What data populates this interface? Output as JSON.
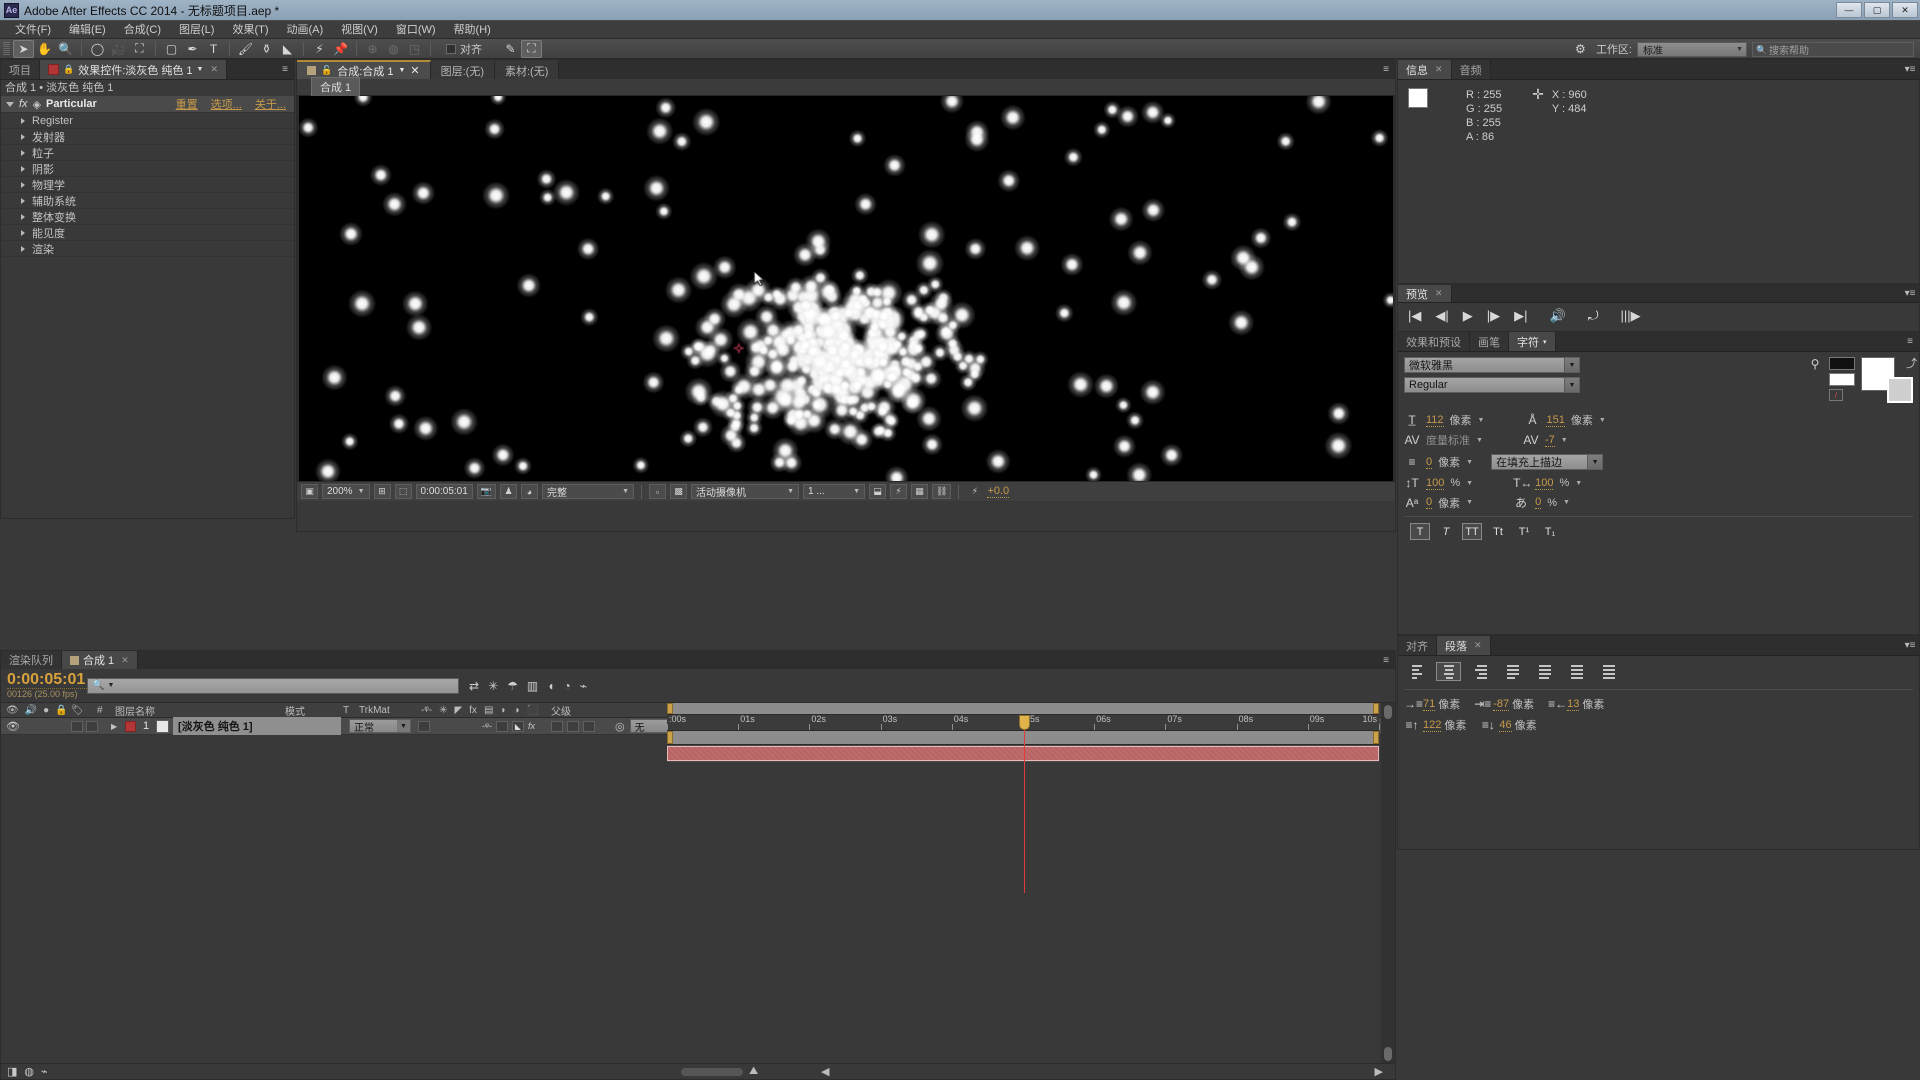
{
  "window": {
    "title": "Adobe After Effects CC 2014 - 无标题项目.aep *",
    "logo": "Ae",
    "minimize": "—",
    "maximize": "▢",
    "close": "✕"
  },
  "menubar": {
    "items": [
      "文件(F)",
      "编辑(E)",
      "合成(C)",
      "图层(L)",
      "效果(T)",
      "动画(A)",
      "视图(V)",
      "窗口(W)",
      "帮助(H)"
    ]
  },
  "toolbar": {
    "tools": [
      {
        "name": "selection-tool",
        "glyph": "➤",
        "active": true
      },
      {
        "name": "hand-tool",
        "glyph": "✋",
        "active": false
      },
      {
        "name": "zoom-tool",
        "glyph": "🔍",
        "active": false
      },
      {
        "name": "rotation-tool",
        "glyph": "◯",
        "active": false
      },
      {
        "name": "camera-tool",
        "glyph": "🎥",
        "active": false
      },
      {
        "name": "pan-behind-tool",
        "glyph": "⛶",
        "active": false
      },
      {
        "name": "shape-tool",
        "glyph": "▢",
        "active": false
      },
      {
        "name": "pen-tool",
        "glyph": "✒",
        "active": false
      },
      {
        "name": "text-tool",
        "glyph": "T",
        "active": false
      },
      {
        "name": "brush-tool",
        "glyph": "🖌",
        "active": false
      },
      {
        "name": "clone-stamp-tool",
        "glyph": "⚱",
        "active": false
      },
      {
        "name": "eraser-tool",
        "glyph": "◣",
        "active": false
      },
      {
        "name": "roto-brush-tool",
        "glyph": "⚡",
        "active": false
      },
      {
        "name": "puppet-pin-tool",
        "glyph": "📌",
        "active": false
      }
    ],
    "align_label": "对齐",
    "workspace_label": "工作区:",
    "workspace_value": "标准",
    "search_placeholder": "搜索帮助"
  },
  "effect_controls": {
    "tabs": [
      {
        "label": "项目",
        "active": false
      },
      {
        "label": "效果控件:淡灰色 纯色 1",
        "active": true
      }
    ],
    "breadcrumb": "合成 1 • 淡灰色 纯色 1",
    "effect_name": "Particular",
    "links": [
      "重置",
      "选项...",
      "关于..."
    ],
    "groups": [
      "Register",
      "发射器",
      "粒子",
      "阴影",
      "物理学",
      "辅助系统",
      "整体变换",
      "能见度",
      "渲染"
    ]
  },
  "composition": {
    "tabs": [
      {
        "label": "合成:合成 1",
        "active": true
      },
      {
        "label": "图层:(无)",
        "active": false
      },
      {
        "label": "素材:(无)",
        "active": false
      }
    ],
    "breadcrumb": "合成 1",
    "viewer_bar": {
      "zoom": "200%",
      "timecode": "0:00:05:01",
      "quality": "完整",
      "camera": "活动摄像机",
      "views": "1 ...",
      "exposure": "+0.0"
    }
  },
  "info_panel": {
    "tabs": [
      {
        "label": "信息",
        "active": true
      },
      {
        "label": "音频",
        "active": false
      }
    ],
    "r_label": "R :",
    "r_value": "255",
    "g_label": "G :",
    "g_value": "255",
    "b_label": "B :",
    "b_value": "255",
    "a_label": "A :",
    "a_value": "86",
    "x_label": "X :",
    "x_value": "960",
    "y_label": "Y :",
    "y_value": "484",
    "swatch_color": "#ffffff"
  },
  "preview_panel": {
    "tab": "预览",
    "buttons": [
      "first-frame",
      "previous-frame",
      "play",
      "next-frame",
      "last-frame",
      "audio",
      "loop",
      "ram-preview"
    ]
  },
  "character_panel": {
    "tabs": [
      {
        "label": "效果和预设",
        "active": false
      },
      {
        "label": "画笔",
        "active": false
      },
      {
        "label": "字符",
        "active": true
      }
    ],
    "font_family": "微软雅黑",
    "font_style": "Regular",
    "font_size": "112",
    "font_size_unit": "像素",
    "leading": "151",
    "leading_unit": "像素",
    "kerning": "度量标准",
    "tracking": "-7",
    "stroke_width": "0",
    "stroke_width_unit": "像素",
    "stroke_order": "在填充上描边",
    "vertical_scale": "100",
    "vertical_scale_unit": "%",
    "horizontal_scale": "100",
    "horizontal_scale_unit": "%",
    "baseline_shift": "0",
    "baseline_shift_unit": "像素",
    "tsume": "0",
    "tsume_unit": "%",
    "style_buttons": [
      "T",
      "T",
      "TT",
      "Tt",
      "T¹",
      "T₁"
    ]
  },
  "paragraph_panel": {
    "tabs": [
      {
        "label": "对齐",
        "active": false
      },
      {
        "label": "段落",
        "active": true
      }
    ],
    "indent_left": "71",
    "indent_left_unit": "像素",
    "indent_first": "-87",
    "indent_first_unit": "像素",
    "indent_right": "13",
    "indent_right_unit": "像素",
    "space_before": "122",
    "space_before_unit": "像素",
    "space_after": "46",
    "space_after_unit": "像素"
  },
  "timeline": {
    "tabs": [
      {
        "label": "渲染队列",
        "active": false
      },
      {
        "label": "合成 1",
        "active": true
      }
    ],
    "current_time": "0:00:05:01",
    "frame_info": "00126 (25.00 fps)",
    "columns": [
      "图层名称",
      "模式",
      "T",
      "TrkMat",
      "父级"
    ],
    "hash_label": "#",
    "layers": [
      {
        "index": "1",
        "name": "[淡灰色 纯色 1]",
        "mode": "正常",
        "parent": "无",
        "label_color": "#b23636",
        "bar_start_pct": 0,
        "bar_end_pct": 100
      }
    ],
    "ruler_labels": [
      ":00s",
      "01s",
      "02s",
      "03s",
      "04s",
      "05s",
      "06s",
      "07s",
      "08s",
      "09s",
      "10s"
    ],
    "playhead_pct": 50.2
  },
  "stage": {
    "background": "#000000",
    "particle_color": "#ffffff",
    "anchor_color": "#8e2b3c"
  }
}
